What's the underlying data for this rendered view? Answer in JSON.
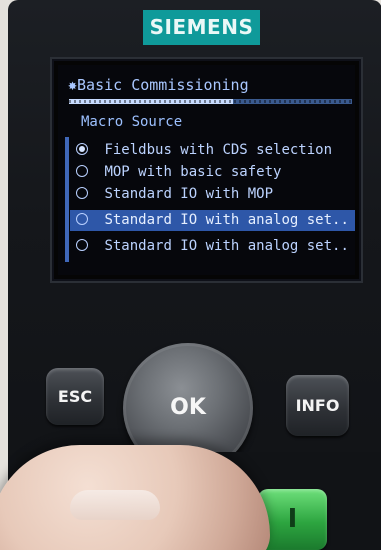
{
  "brand": {
    "name": "SIEMENS"
  },
  "screen": {
    "title": "✸Basic Commissioning",
    "subtitle": "Macro Source",
    "items": [
      {
        "label": "Fieldbus with CDS selection",
        "checked": true,
        "selected": false
      },
      {
        "label": "MOP with basic safety",
        "checked": false,
        "selected": false
      },
      {
        "label": "Standard IO with MOP",
        "checked": false,
        "selected": false
      },
      {
        "label": "Standard IO with analog set..",
        "checked": false,
        "selected": true
      },
      {
        "label": "Standard IO with analog set..",
        "checked": false,
        "selected": false
      }
    ]
  },
  "buttons": {
    "esc": "ESC",
    "ok": "OK",
    "info": "INFO",
    "start": "I"
  },
  "colors": {
    "logo_teal": "#0f9a9a",
    "lcd_text": "#bcd3ff",
    "lcd_highlight": "#2e57a8",
    "start_green": "#2da540"
  },
  "progress": {
    "value": 0.58
  }
}
